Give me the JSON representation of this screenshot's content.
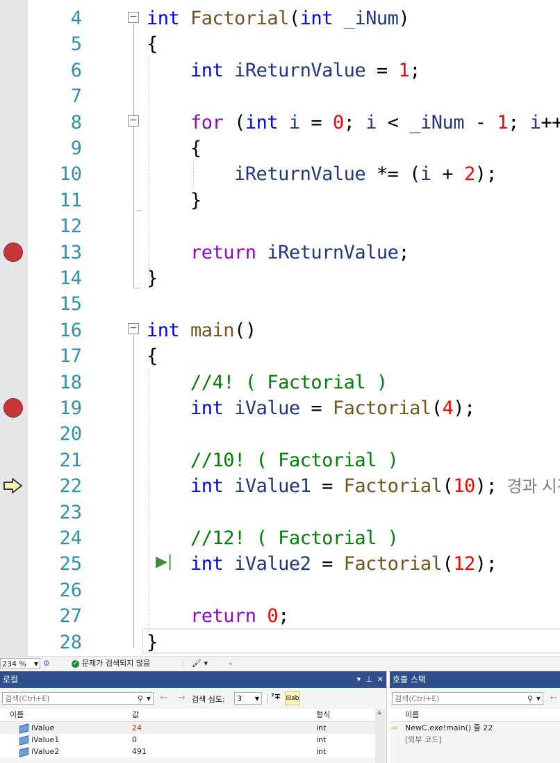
{
  "editor": {
    "lines": [
      {
        "num": "4",
        "tokens": [
          [
            "kw",
            "int"
          ],
          [
            "",
            " "
          ],
          [
            "fn",
            "Factorial"
          ],
          [
            "",
            "("
          ],
          [
            "kw",
            "int"
          ],
          [
            "",
            ""
          ],
          [
            "var",
            " _iNum"
          ],
          [
            "",
            ")"
          ]
        ]
      },
      {
        "num": "5",
        "tokens": [
          [
            "",
            "{"
          ]
        ]
      },
      {
        "num": "6",
        "tokens": [
          [
            "",
            "    "
          ],
          [
            "kw",
            "int"
          ],
          [
            "var",
            " iReturnValue"
          ],
          [
            "",
            " = "
          ],
          [
            "num",
            "1"
          ],
          [
            "",
            ";"
          ]
        ]
      },
      {
        "num": "7",
        "tokens": []
      },
      {
        "num": "8",
        "tokens": [
          [
            "",
            "    "
          ],
          [
            "ctl",
            "for"
          ],
          [
            "",
            " ("
          ],
          [
            "kw",
            "int"
          ],
          [
            "var",
            " i"
          ],
          [
            "",
            " = "
          ],
          [
            "num",
            "0"
          ],
          [
            "",
            "; "
          ],
          [
            "var",
            "i"
          ],
          [
            "",
            " < "
          ],
          [
            "var",
            "_iNum"
          ],
          [
            "",
            " - "
          ],
          [
            "num",
            "1"
          ],
          [
            "",
            "; "
          ],
          [
            "var",
            "i"
          ],
          [
            "",
            "++)"
          ]
        ]
      },
      {
        "num": "9",
        "tokens": [
          [
            "",
            "    {"
          ]
        ]
      },
      {
        "num": "10",
        "tokens": [
          [
            "",
            "        "
          ],
          [
            "var",
            "iReturnValue"
          ],
          [
            "",
            " *= ("
          ],
          [
            "var",
            "i"
          ],
          [
            "",
            " + "
          ],
          [
            "num",
            "2"
          ],
          [
            "",
            ");"
          ]
        ]
      },
      {
        "num": "11",
        "tokens": [
          [
            "",
            "    }"
          ]
        ]
      },
      {
        "num": "12",
        "tokens": []
      },
      {
        "num": "13",
        "tokens": [
          [
            "",
            "    "
          ],
          [
            "ctl",
            "return"
          ],
          [
            "var",
            " iReturnValue"
          ],
          [
            "",
            ";"
          ]
        ]
      },
      {
        "num": "14",
        "tokens": [
          [
            "",
            "}"
          ]
        ]
      },
      {
        "num": "15",
        "tokens": []
      },
      {
        "num": "16",
        "tokens": [
          [
            "kw",
            "int"
          ],
          [
            "fn",
            " main"
          ],
          [
            "",
            "()"
          ]
        ]
      },
      {
        "num": "17",
        "tokens": [
          [
            "",
            "{"
          ]
        ]
      },
      {
        "num": "18",
        "tokens": [
          [
            "",
            "    "
          ],
          [
            "cm",
            "//4! ( Factorial )"
          ]
        ]
      },
      {
        "num": "19",
        "tokens": [
          [
            "",
            "    "
          ],
          [
            "kw",
            "int"
          ],
          [
            "var",
            " iValue"
          ],
          [
            "",
            " = "
          ],
          [
            "fn",
            "Factorial"
          ],
          [
            "",
            "("
          ],
          [
            "num",
            "4"
          ],
          [
            "",
            ");"
          ]
        ]
      },
      {
        "num": "20",
        "tokens": []
      },
      {
        "num": "21",
        "tokens": [
          [
            "",
            "    "
          ],
          [
            "cm",
            "//10! ( Factorial )"
          ]
        ]
      },
      {
        "num": "22",
        "tokens": [
          [
            "",
            "    "
          ],
          [
            "kw",
            "int"
          ],
          [
            "var",
            " iValue1"
          ],
          [
            "",
            " = "
          ],
          [
            "fn",
            "Factorial"
          ],
          [
            "",
            "("
          ],
          [
            "num",
            "10"
          ],
          [
            "",
            ");"
          ],
          [
            "hint",
            "  경과 시간"
          ]
        ]
      },
      {
        "num": "23",
        "tokens": []
      },
      {
        "num": "24",
        "tokens": [
          [
            "",
            "    "
          ],
          [
            "cm",
            "//12! ( Factorial )"
          ]
        ]
      },
      {
        "num": "25",
        "tokens": [
          [
            "",
            "    "
          ],
          [
            "kw",
            "int"
          ],
          [
            "var",
            " iValue2"
          ],
          [
            "",
            " = "
          ],
          [
            "fn",
            "Factorial"
          ],
          [
            "",
            "("
          ],
          [
            "num",
            "12"
          ],
          [
            "",
            ");"
          ]
        ]
      },
      {
        "num": "26",
        "tokens": []
      },
      {
        "num": "27",
        "tokens": [
          [
            "",
            "    "
          ],
          [
            "ctl",
            "return"
          ],
          [
            "",
            " "
          ],
          [
            "num",
            "0"
          ],
          [
            "",
            ";"
          ]
        ]
      },
      {
        "num": "28",
        "tokens": [
          [
            "",
            "}"
          ]
        ]
      }
    ],
    "breakpoint_lines": [
      "13",
      "19"
    ],
    "current_line": "22",
    "run_to_click_line": "25",
    "run_to_click_glyph": "▶|"
  },
  "statusbar": {
    "zoom": "234 %",
    "issues": "문제가 검색되지 않음"
  },
  "locals": {
    "title": "로컬",
    "search_placeholder": "검색(Ctrl+E)",
    "depth_label": "검색 심도:",
    "depth_value": "3",
    "columns": [
      "이름",
      "값",
      "형식"
    ],
    "rows": [
      {
        "name": "iValue",
        "value": "24",
        "type": "int",
        "changed": true
      },
      {
        "name": "iValue1",
        "value": "0",
        "type": "int",
        "changed": false
      },
      {
        "name": "iValue2",
        "value": "491",
        "type": "int",
        "changed": false
      }
    ]
  },
  "callstack": {
    "title": "호출 스택",
    "search_placeholder": "검색(Ctrl+E)",
    "columns": [
      "이름"
    ],
    "rows": [
      {
        "name": "NewC.exe!main() 줄 22",
        "current": true
      },
      {
        "name": "[외부 코드]",
        "current": false
      }
    ]
  },
  "colors": {
    "keyword": "#0000ff",
    "control": "#8f08c4",
    "function": "#74531f",
    "variable": "#1f377f",
    "number": "#ff0000",
    "comment": "#008000",
    "breakpoint": "#c4383b",
    "panel_title": "#2d4f8e"
  }
}
